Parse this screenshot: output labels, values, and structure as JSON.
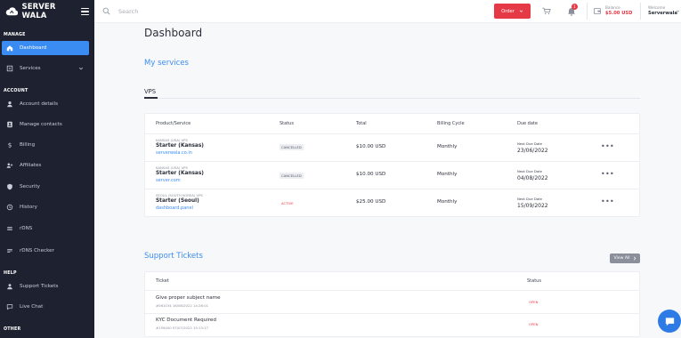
{
  "brand": {
    "name": "SERVER WALA"
  },
  "sidebar": {
    "sections": {
      "manage": "MANAGE",
      "account": "ACCOUNT",
      "help": "HELP",
      "other": "OTHER"
    },
    "items": [
      {
        "label": "Dashboard",
        "icon": "home-icon"
      },
      {
        "label": "Services",
        "icon": "services-icon"
      },
      {
        "label": "Account details",
        "icon": "user-icon"
      },
      {
        "label": "Manage contacts",
        "icon": "contacts-icon"
      },
      {
        "label": "Billing",
        "icon": "dollar-icon"
      },
      {
        "label": "Affiliates",
        "icon": "affiliates-icon"
      },
      {
        "label": "Security",
        "icon": "shield-icon"
      },
      {
        "label": "History",
        "icon": "history-icon"
      },
      {
        "label": "rDNS",
        "icon": "dns-icon"
      },
      {
        "label": "rDNS Checker",
        "icon": "dns-checker-icon"
      },
      {
        "label": "Support Tickets",
        "icon": "support-icon"
      },
      {
        "label": "Live Chat",
        "icon": "chat-icon"
      }
    ]
  },
  "header": {
    "search_placeholder": "Search",
    "order_label": "Order",
    "notification_count": "1",
    "balance_label": "Balance",
    "balance_value": "$5.00 USD",
    "welcome_label": "Welcome",
    "username": "Serverwala"
  },
  "main": {
    "title": "Dashboard",
    "services_heading": "My services",
    "tab": "VPS",
    "columns": [
      "Product/Service",
      "Status",
      "Total",
      "Billing Cycle",
      "Due date"
    ],
    "services": [
      {
        "location": "KANSAS (USA) VPS",
        "name": "Starter (Kansas)",
        "host": "serverwala.co.in",
        "status": "CANCELLED",
        "total": "$10.00 USD",
        "cycle": "Monthly",
        "due_label": "Next Due Date",
        "due_date": "23/06/2022"
      },
      {
        "location": "KANSAS (USA) VPS",
        "name": "Starter (Kansas)",
        "host": "server.com",
        "status": "CANCELLED",
        "total": "$10.00 USD",
        "cycle": "Monthly",
        "due_label": "Next Due Date",
        "due_date": "04/08/2022"
      },
      {
        "location": "SEOUL (SOUTH KOREA) VPS",
        "name": "Starter (Seoul)",
        "host": "dashboard.panel",
        "status": "ACTIVE",
        "total": "$25.00 USD",
        "cycle": "Monthly",
        "due_label": "Next Due Date",
        "due_date": "15/09/2022"
      }
    ],
    "tickets_heading": "Support Tickets",
    "view_all_label": "View All",
    "ticket_columns": [
      "Ticket",
      "Status"
    ],
    "tickets": [
      {
        "subject": "Give proper subject name",
        "meta": "#061034  16/08/2022 14:26:01",
        "status": "OPEN"
      },
      {
        "subject": "KYC Document Required",
        "meta": "#159400  07/07/2022 15:13:17",
        "status": "OPEN"
      }
    ]
  },
  "colors": {
    "accent": "#3b8cf2",
    "sidebar_bg": "#1e2230",
    "danger": "#e63946"
  }
}
